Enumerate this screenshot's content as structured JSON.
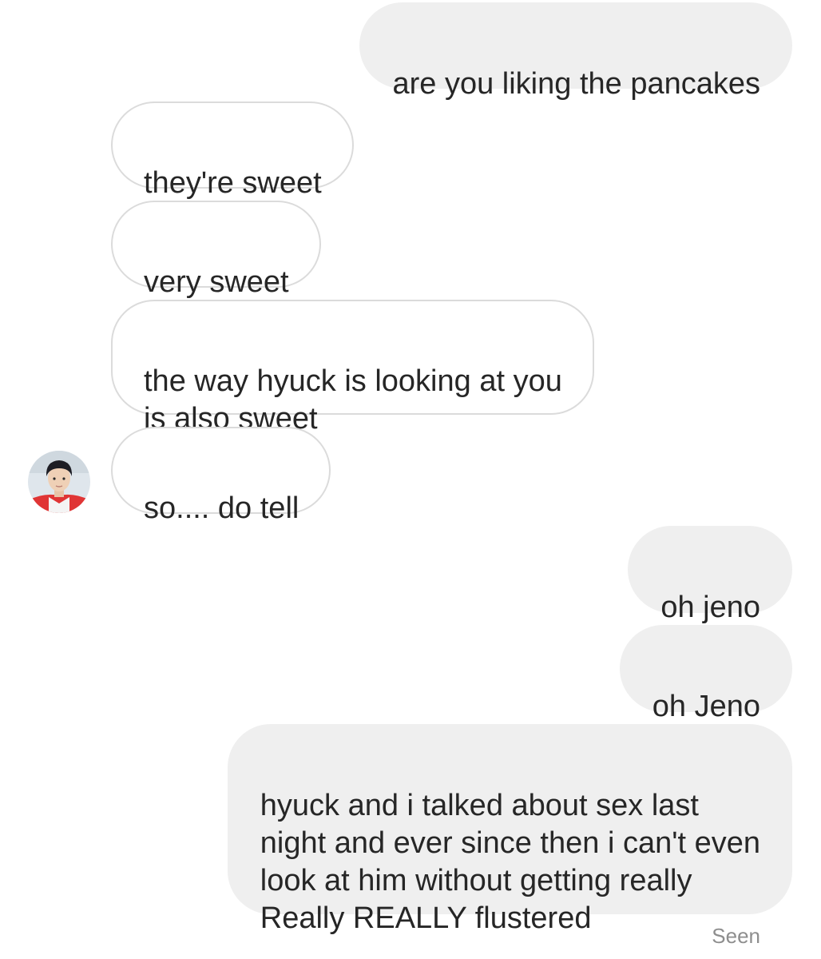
{
  "thread": {
    "messages": [
      {
        "direction": "sent",
        "text": "are you liking the pancakes"
      },
      {
        "direction": "received",
        "text": "they're sweet"
      },
      {
        "direction": "received",
        "text": "very sweet"
      },
      {
        "direction": "received",
        "text": "the way hyuck is looking at you\nis also sweet"
      },
      {
        "direction": "received",
        "text": "so.... do tell"
      },
      {
        "direction": "sent",
        "text": "oh jeno"
      },
      {
        "direction": "sent",
        "text": "oh Jeno"
      },
      {
        "direction": "sent",
        "text": "hyuck and i talked about sex last\nnight and ever since then i can't even\nlook at him without getting really\nReally REALLY flustered"
      }
    ],
    "status": "Seen"
  },
  "colors": {
    "sent_bubble": "#efefef",
    "received_border": "#dbdbdb",
    "text": "#262626",
    "status_text": "#8e8e8e"
  },
  "icons": {
    "avatar": "contact-avatar-photo"
  }
}
